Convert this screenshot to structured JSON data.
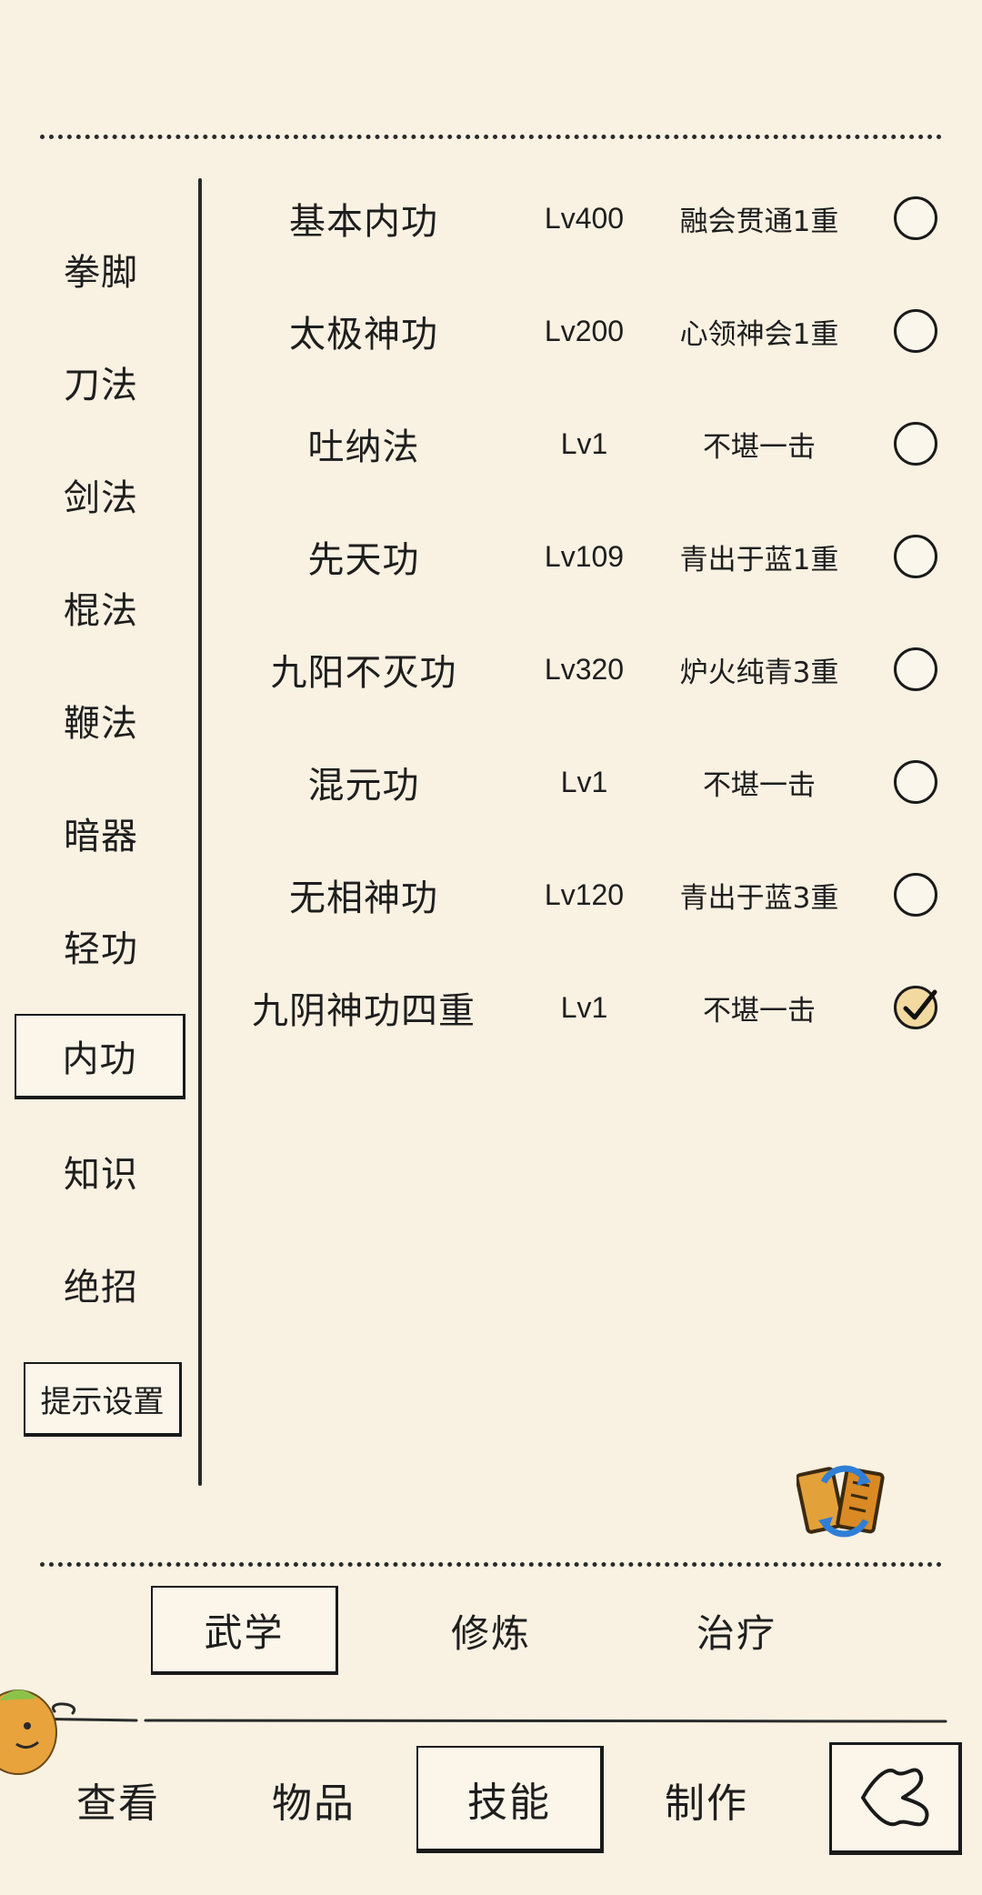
{
  "sidebar": {
    "categories": [
      {
        "label": "拳脚"
      },
      {
        "label": "刀法"
      },
      {
        "label": "剑法"
      },
      {
        "label": "棍法"
      },
      {
        "label": "鞭法"
      },
      {
        "label": "暗器"
      },
      {
        "label": "轻功"
      },
      {
        "label": "内功",
        "active": true
      },
      {
        "label": "知识"
      },
      {
        "label": "绝招"
      }
    ],
    "hint_button": "提示设置"
  },
  "skills": [
    {
      "name": "基本内功",
      "level": "Lv400",
      "rank": "融会贯通1重",
      "selected": false
    },
    {
      "name": "太极神功",
      "level": "Lv200",
      "rank": "心领神会1重",
      "selected": false
    },
    {
      "name": "吐纳法",
      "level": "Lv1",
      "rank": "不堪一击",
      "selected": false
    },
    {
      "name": "先天功",
      "level": "Lv109",
      "rank": "青出于蓝1重",
      "selected": false
    },
    {
      "name": "九阳不灭功",
      "level": "Lv320",
      "rank": "炉火纯青3重",
      "selected": false
    },
    {
      "name": "混元功",
      "level": "Lv1",
      "rank": "不堪一击",
      "selected": false
    },
    {
      "name": "无相神功",
      "level": "Lv120",
      "rank": "青出于蓝3重",
      "selected": false
    },
    {
      "name": "九阴神功四重",
      "level": "Lv1",
      "rank": "不堪一击",
      "selected": true
    }
  ],
  "subtabs": [
    {
      "label": "武学",
      "active": true
    },
    {
      "label": "修炼"
    },
    {
      "label": "治疗"
    }
  ],
  "nav": [
    {
      "label": "查看"
    },
    {
      "label": "物品"
    },
    {
      "label": "技能",
      "active": true
    },
    {
      "label": "制作"
    }
  ],
  "icons": {
    "refresh": "swap-refresh-icon",
    "back": "back-arrow-icon",
    "mascot": "mascot-icon"
  }
}
